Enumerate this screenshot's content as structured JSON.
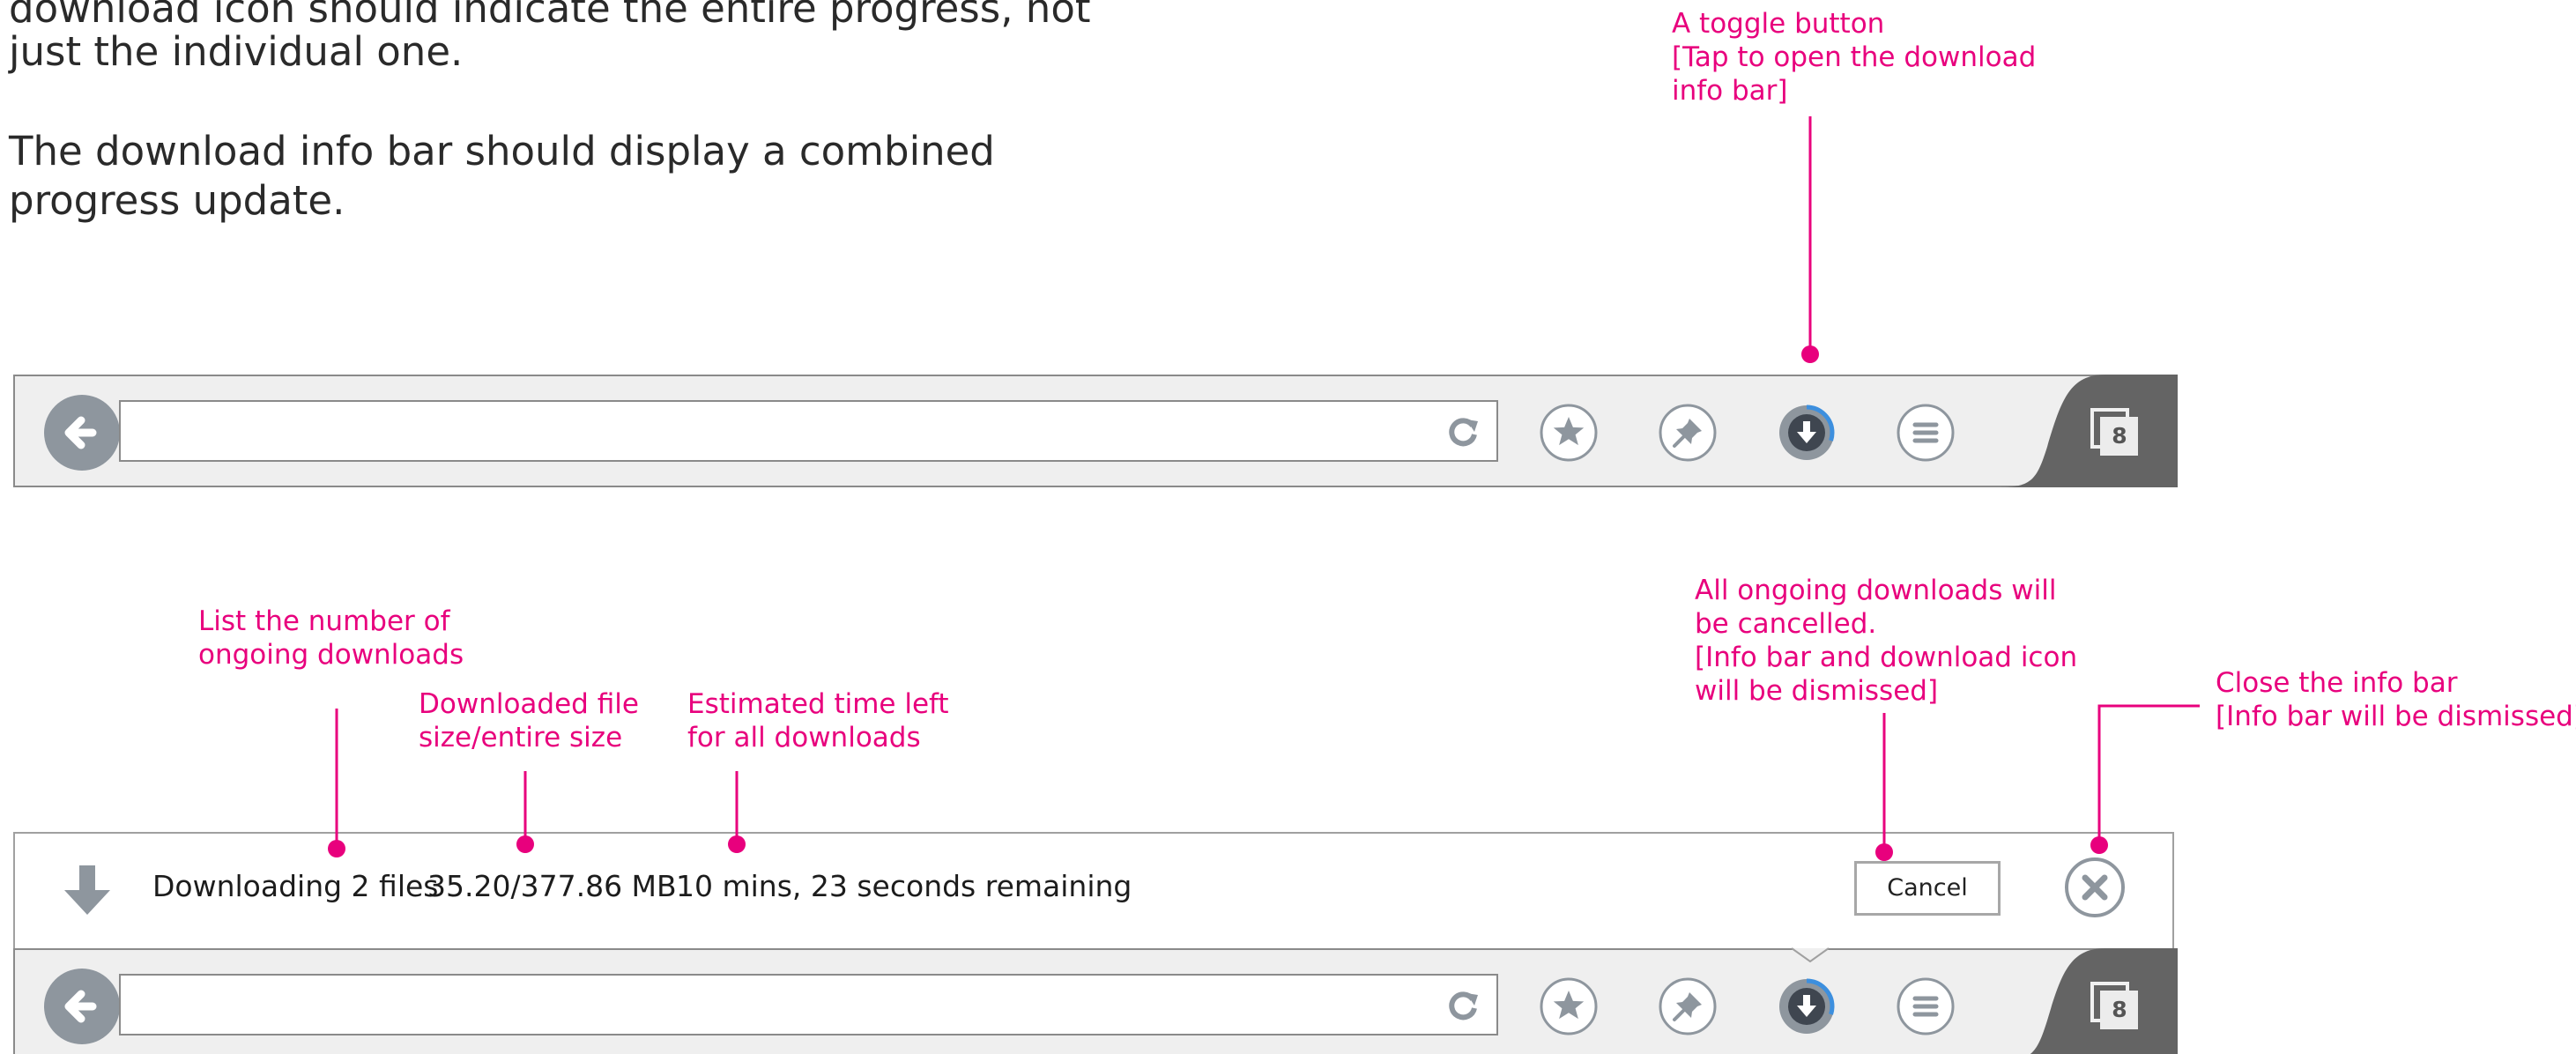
{
  "intro": {
    "line1": "download icon should indicate the entire progress, not",
    "line2": "just the individual one.",
    "line3": "The download info bar should display a combined",
    "line4": "progress update."
  },
  "annotations": {
    "toggle": [
      "A toggle button",
      "[Tap to open the download",
      "info bar]"
    ],
    "count": [
      "List the number of",
      "ongoing downloads"
    ],
    "size": [
      "Downloaded file",
      "size/entire size"
    ],
    "time": [
      "Estimated time left",
      "for all downloads"
    ],
    "cancel": [
      "All ongoing downloads will",
      "be cancelled.",
      "[Info bar and download icon",
      "will be dismissed]"
    ],
    "close": [
      "Close the info bar",
      "[Info bar will be dismissed]"
    ]
  },
  "toolbar": {
    "tab_count": "8",
    "download_progress": 0.3,
    "icons": [
      "back-arrow-icon",
      "refresh-icon",
      "star-icon",
      "pin-icon",
      "download-icon",
      "menu-icon",
      "tabs-icon"
    ]
  },
  "info_bar": {
    "status": "Downloading 2 files",
    "size": "35.20/377.86 MB",
    "time_remaining": "10 mins, 23 seconds remaining",
    "cancel_label": "Cancel",
    "icons": [
      "download-arrow-icon",
      "close-icon"
    ]
  },
  "colors": {
    "annotation": "#e8007d",
    "progress_ring": "#3d8fde",
    "toolbar_background": "#efefef",
    "tabs_background": "#646464",
    "icon_gray": "#8e969e"
  }
}
